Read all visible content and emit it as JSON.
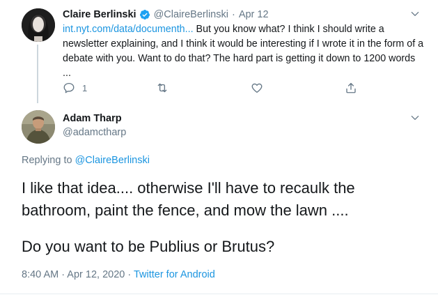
{
  "parent_tweet": {
    "author_name": "Claire Berlinski",
    "author_handle": "@ClaireBerlinski",
    "separator": "·",
    "date": "Apr 12",
    "link_text": "int.nyt.com/data/documenth...",
    "text": " But you know what? I think I should write a newsletter explaining, and I think it would be interesting if I wrote it in the form of a debate with you. Want to do that? The hard part is getting it down to 1200 words ...",
    "reply_count": "1",
    "verified": true
  },
  "main_tweet": {
    "author_name": "Adam Tharp",
    "author_handle": "@adamctharp",
    "replying_prefix": "Replying to",
    "replying_to": "@ClaireBerlinski",
    "body_line_1": "I like that idea.... otherwise I'll have to recaulk the bathroom, paint the fence, and mow the lawn ....",
    "body_line_2": "Do you want to be Publius or Brutus?",
    "timestamp": "8:40 AM · Apr 12, 2020",
    "meta_separator": " · ",
    "source": "Twitter for Android"
  },
  "colors": {
    "text": "#14171a",
    "secondary": "#657786",
    "link": "#1b95e0",
    "verified": "#1da1f2",
    "thread_line": "#ccd6dd"
  },
  "icons": [
    "verified-badge-icon",
    "chevron-down-icon",
    "reply-icon",
    "retweet-icon",
    "like-icon",
    "share-icon"
  ]
}
